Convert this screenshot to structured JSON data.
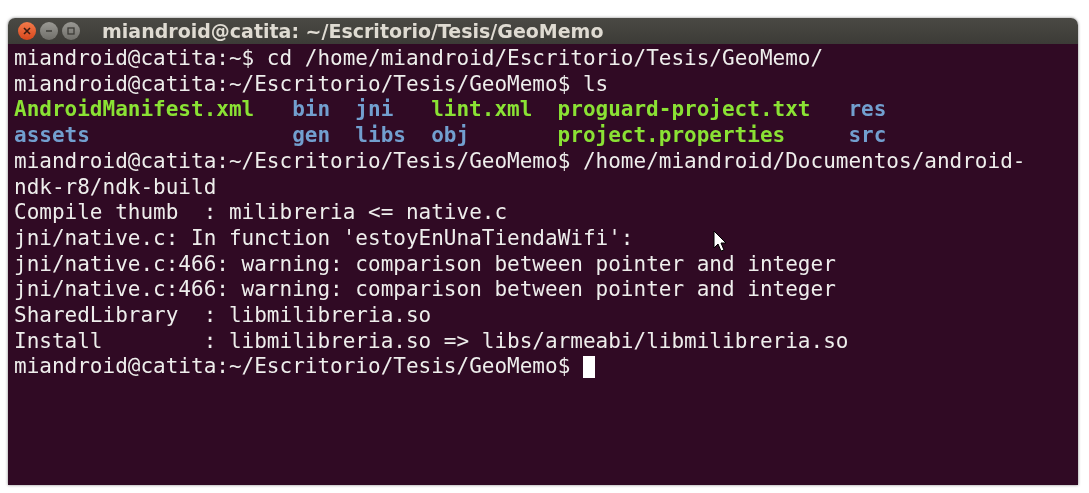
{
  "window": {
    "title": "miandroid@catita: ~/Escritorio/Tesis/GeoMemo"
  },
  "terminal": {
    "lines": [
      {
        "kind": "text",
        "text": "miandroid@catita:~$ cd /home/miandroid/Escritorio/Tesis/GeoMemo/"
      },
      {
        "kind": "text",
        "text": "miandroid@catita:~/Escritorio/Tesis/GeoMemo$ ls"
      },
      {
        "kind": "listing",
        "entries": [
          {
            "name": "AndroidManifest.xml",
            "color": "#8ae234"
          },
          {
            "name": "bin",
            "color": "#729fcf"
          },
          {
            "name": "jni",
            "color": "#729fcf"
          },
          {
            "name": "lint.xml",
            "color": "#8ae234"
          },
          {
            "name": "proguard-project.txt",
            "color": "#8ae234"
          },
          {
            "name": "res",
            "color": "#729fcf"
          }
        ]
      },
      {
        "kind": "listing",
        "entries": [
          {
            "name": "assets",
            "color": "#729fcf"
          },
          {
            "name": "gen",
            "color": "#729fcf"
          },
          {
            "name": "libs",
            "color": "#729fcf"
          },
          {
            "name": "obj",
            "color": "#729fcf"
          },
          {
            "name": "project.properties",
            "color": "#8ae234"
          },
          {
            "name": "src",
            "color": "#729fcf"
          }
        ]
      },
      {
        "kind": "text",
        "text": "miandroid@catita:~/Escritorio/Tesis/GeoMemo$ /home/miandroid/Documentos/android-"
      },
      {
        "kind": "text",
        "text": "ndk-r8/ndk-build"
      },
      {
        "kind": "text",
        "text": "Compile thumb  : milibreria <= native.c"
      },
      {
        "kind": "text",
        "text": "jni/native.c: In function 'estoyEnUnaTiendaWifi':"
      },
      {
        "kind": "text",
        "text": "jni/native.c:466: warning: comparison between pointer and integer"
      },
      {
        "kind": "text",
        "text": "jni/native.c:466: warning: comparison between pointer and integer"
      },
      {
        "kind": "text",
        "text": "SharedLibrary  : libmilibreria.so"
      },
      {
        "kind": "text",
        "text": "Install        : libmilibreria.so => libs/armeabi/libmilibreria.so"
      },
      {
        "kind": "prompt",
        "text": "miandroid@catita:~/Escritorio/Tesis/GeoMemo$"
      }
    ]
  }
}
